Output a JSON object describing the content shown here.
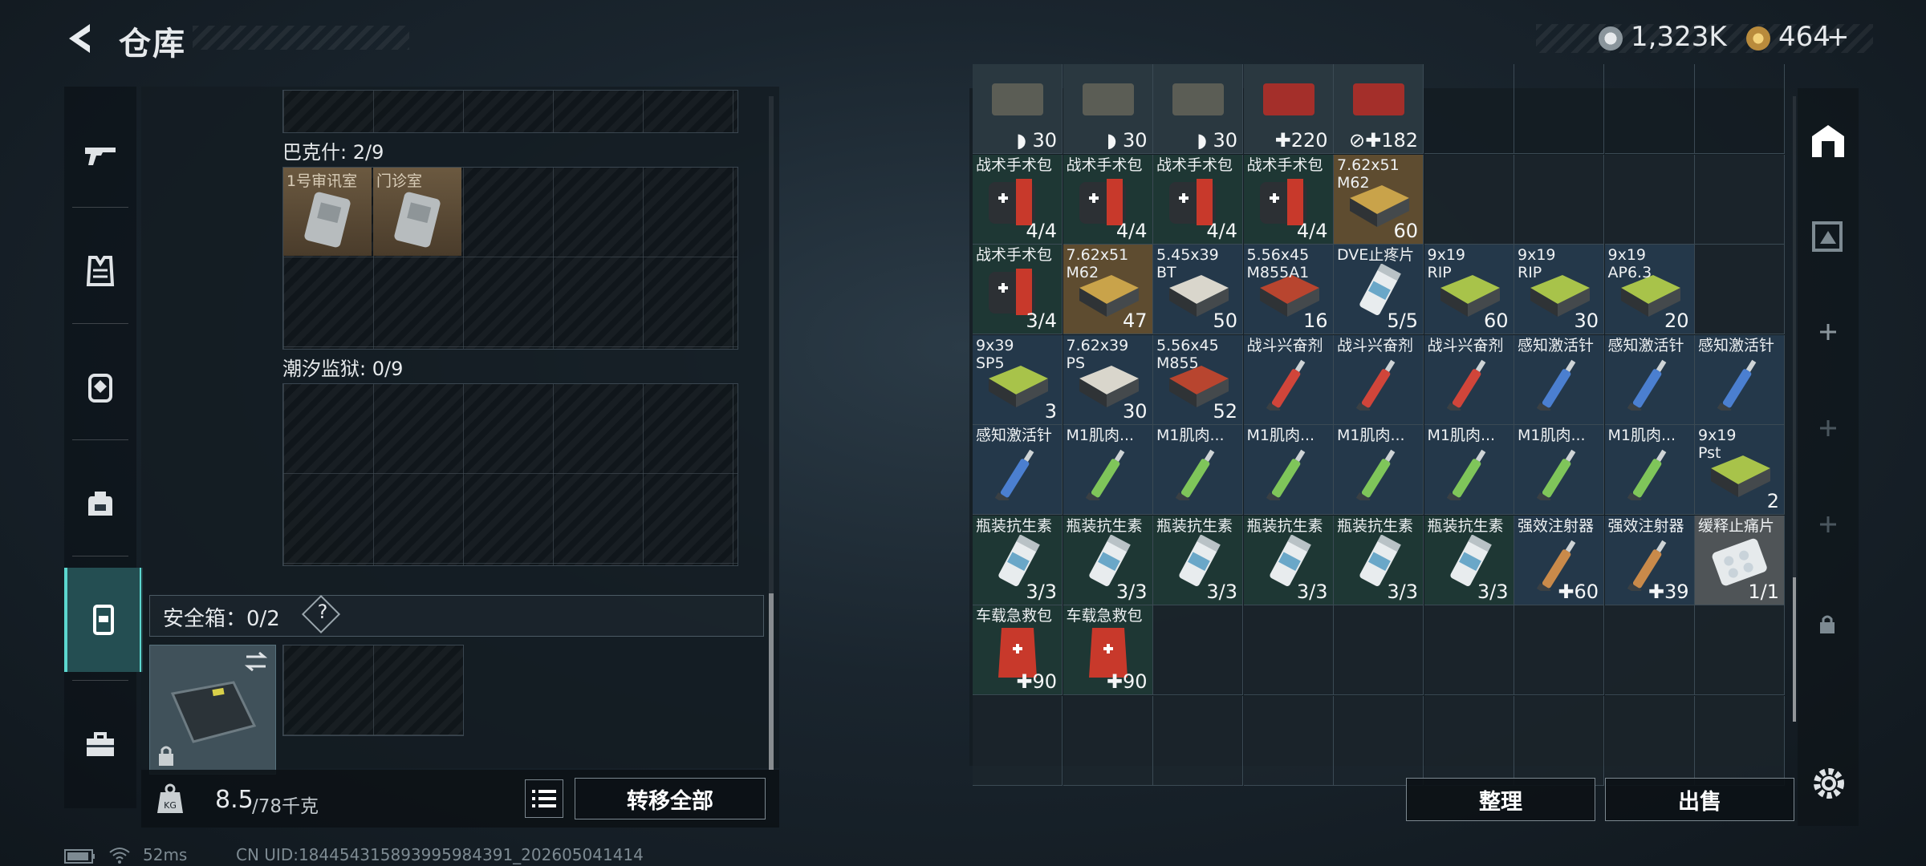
{
  "header": {
    "title": "仓库",
    "currency1": "1,323K",
    "currency2": "464",
    "plus_label": "+"
  },
  "colors": {
    "accent": "#5cd7cf",
    "first_aid_red": "#c8392b",
    "cell_teal": "#1f3a38",
    "cell_blue": "#23394a",
    "cell_gold": "#6b5634"
  },
  "left_nav": {
    "items": [
      {
        "icon": "gun-icon"
      },
      {
        "icon": "armor-vest-icon"
      },
      {
        "icon": "helmet-icon"
      },
      {
        "icon": "backpack-icon"
      },
      {
        "icon": "safebox-icon",
        "active": true
      },
      {
        "icon": "toolbox-icon"
      }
    ]
  },
  "left_panel": {
    "section1_label": "巴克什: 2/9",
    "section1_items": [
      "1号审讯室",
      "门诊室"
    ],
    "section2_label": "潮汐监狱: 0/9",
    "safe_box_label": "安全箱：0/2",
    "safe_box_help": "?",
    "weight_current": "8.5",
    "weight_max": "/78千克",
    "weight_icon_text": "KG",
    "transfer_all_label": "转移全部"
  },
  "right_panel": {
    "sort_label": "整理",
    "sell_label": "出售",
    "rows": [
      [
        {
          "label": "",
          "count": "30",
          "badge": "shield"
        },
        {
          "label": "",
          "count": "30",
          "badge": "shield"
        },
        {
          "label": "",
          "count": "30",
          "badge": "shield"
        },
        {
          "label": "",
          "count": "220",
          "badge": "plus"
        },
        {
          "label": "",
          "count": "182",
          "badge": "noplus"
        }
      ],
      [
        {
          "label": "战术手术包",
          "count": "4/4",
          "kind": "kit"
        },
        {
          "label": "战术手术包",
          "count": "4/4",
          "kind": "kit"
        },
        {
          "label": "战术手术包",
          "count": "4/4",
          "kind": "kit"
        },
        {
          "label": "战术手术包",
          "count": "4/4",
          "kind": "kit"
        },
        {
          "label": "7.62x51\nM62",
          "count": "60",
          "kind": "ammo-gold"
        }
      ],
      [
        {
          "label": "战术手术包",
          "count": "3/4",
          "kind": "kit"
        },
        {
          "label": "7.62x51\nM62",
          "count": "47",
          "kind": "ammo-gold"
        },
        {
          "label": "5.45x39\nBT",
          "count": "50",
          "kind": "ammo-white"
        },
        {
          "label": "5.56x45\nM855A1",
          "count": "16",
          "kind": "ammo-red"
        },
        {
          "label": "DVE止疼片",
          "count": "5/5",
          "kind": "pills"
        },
        {
          "label": "9x19\nRIP",
          "count": "60",
          "kind": "ammo-green"
        },
        {
          "label": "9x19\nRIP",
          "count": "30",
          "kind": "ammo-green"
        },
        {
          "label": "9x19\nAP6.3",
          "count": "20",
          "kind": "ammo-green"
        }
      ],
      [
        {
          "label": "9x39\nSP5",
          "count": "3",
          "kind": "ammo-green"
        },
        {
          "label": "7.62x39\nPS",
          "count": "30",
          "kind": "ammo-white"
        },
        {
          "label": "5.56x45\nM855",
          "count": "52",
          "kind": "ammo-red"
        },
        {
          "label": "战斗兴奋剂",
          "count": "",
          "kind": "syringe-red"
        },
        {
          "label": "战斗兴奋剂",
          "count": "",
          "kind": "syringe-red"
        },
        {
          "label": "战斗兴奋剂",
          "count": "",
          "kind": "syringe-red"
        },
        {
          "label": "感知激活针",
          "count": "",
          "kind": "syringe-blue"
        },
        {
          "label": "感知激活针",
          "count": "",
          "kind": "syringe-blue"
        },
        {
          "label": "感知激活针",
          "count": "",
          "kind": "syringe-blue"
        }
      ],
      [
        {
          "label": "感知激活针",
          "count": "",
          "kind": "syringe-blue"
        },
        {
          "label": "M1肌肉...",
          "count": "",
          "kind": "syringe-green"
        },
        {
          "label": "M1肌肉...",
          "count": "",
          "kind": "syringe-green"
        },
        {
          "label": "M1肌肉...",
          "count": "",
          "kind": "syringe-green"
        },
        {
          "label": "M1肌肉...",
          "count": "",
          "kind": "syringe-green"
        },
        {
          "label": "M1肌肉...",
          "count": "",
          "kind": "syringe-green"
        },
        {
          "label": "M1肌肉...",
          "count": "",
          "kind": "syringe-green"
        },
        {
          "label": "M1肌肉...",
          "count": "",
          "kind": "syringe-green"
        },
        {
          "label": "9x19\nPst",
          "count": "2",
          "kind": "ammo-green"
        }
      ],
      [
        {
          "label": "瓶装抗生素",
          "count": "3/3",
          "kind": "bottle"
        },
        {
          "label": "瓶装抗生素",
          "count": "3/3",
          "kind": "bottle"
        },
        {
          "label": "瓶装抗生素",
          "count": "3/3",
          "kind": "bottle"
        },
        {
          "label": "瓶装抗生素",
          "count": "3/3",
          "kind": "bottle"
        },
        {
          "label": "瓶装抗生素",
          "count": "3/3",
          "kind": "bottle"
        },
        {
          "label": "瓶装抗生素",
          "count": "3/3",
          "kind": "bottle"
        },
        {
          "label": "强效注射器",
          "count": "60",
          "kind": "syringe-orange"
        },
        {
          "label": "强效注射器",
          "count": "39",
          "kind": "syringe-orange"
        },
        {
          "label": "缓释止痛片",
          "count": "1/1",
          "kind": "pills-blister"
        }
      ],
      [
        {
          "label": "车载急救包",
          "count": "90",
          "kind": "firstaid-bag"
        },
        {
          "label": "车载急救包",
          "count": "90",
          "kind": "firstaid-bag"
        }
      ]
    ]
  },
  "status_bar": {
    "ping": "52ms",
    "uid": "CN UID:184454315893995984391_202605041414"
  }
}
